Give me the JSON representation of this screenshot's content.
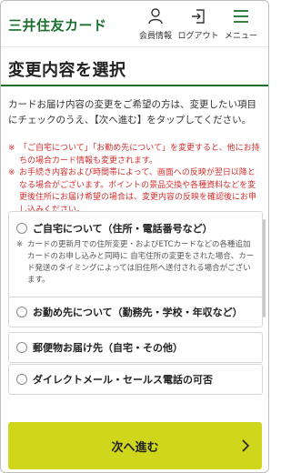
{
  "header": {
    "logo": "三井住友カード",
    "member_label": "会員情報",
    "logout_label": "ログアウト",
    "menu_label": "メニュー"
  },
  "page": {
    "title": "変更内容を選択",
    "intro": "カードお届け内容の変更をご希望の方は、変更したい項目にチェックのうえ、【次へ進む】をタップしてください。",
    "note1": "「ご自宅について」「お勤め先について」を変更すると、他にお持ちの場合カード情報も変更されます。",
    "note2": "お手続き内容および時間帯によって、画面への反映が翌日以降となる場合がございます。ポイントの景品交換や各種資料などを変更後住所にお届け希望の場合は、変更内容の反映を確認後にお申し込みください。",
    "note_mark": "※"
  },
  "options": [
    {
      "label": "ご自宅について（住所・電話番号など）",
      "note": "カードの更新月での住所変更・およびETCカードなどの各種追加カードのお申し込みと同時に 自宅住所の変更をされた場合、カード発送のタイミングによっては旧住所へ送付される場合がございます。"
    },
    {
      "label": "お勤め先について（勤務先・学校・年収など）"
    },
    {
      "label": "郵便物お届け先（自宅・その他）"
    },
    {
      "label": "ダイレクトメール・セールス電話の可否"
    }
  ],
  "next_button": {
    "label": "次へ進む"
  },
  "colors": {
    "brand_green": "#1a6e2e",
    "accent_lime": "#cfd61b",
    "warning_red": "#d32f2f"
  }
}
